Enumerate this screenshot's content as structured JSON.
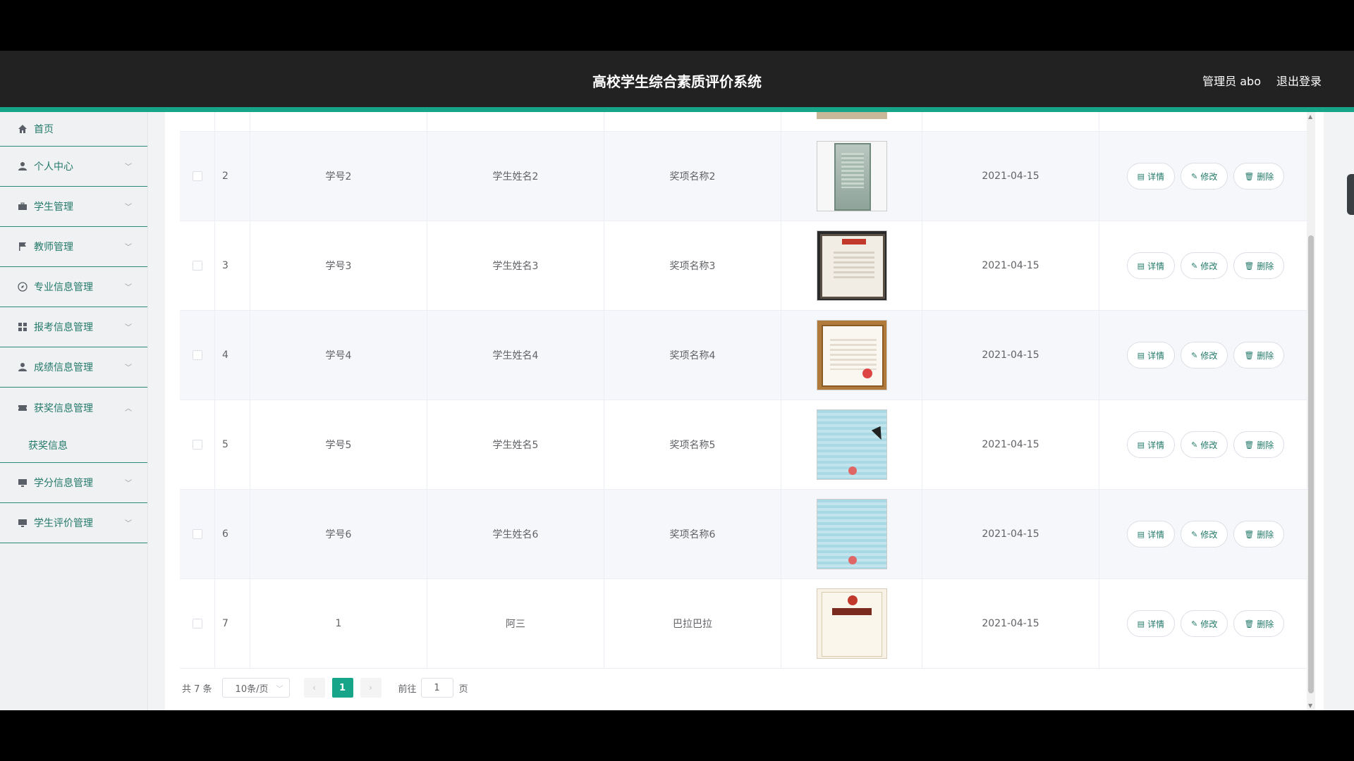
{
  "header": {
    "title": "高校学生综合素质评价系统",
    "user": "管理员 abo",
    "logout": "退出登录"
  },
  "sidebar": {
    "items": [
      {
        "label": "首页",
        "icon": "home-icon"
      },
      {
        "label": "个人中心",
        "icon": "user-icon"
      },
      {
        "label": "学生管理",
        "icon": "briefcase-icon"
      },
      {
        "label": "教师管理",
        "icon": "flag-icon"
      },
      {
        "label": "专业信息管理",
        "icon": "compass-icon"
      },
      {
        "label": "报考信息管理",
        "icon": "grid-icon"
      },
      {
        "label": "成绩信息管理",
        "icon": "user-icon"
      },
      {
        "label": "获奖信息管理",
        "icon": "ticket-icon"
      },
      {
        "label": "学分信息管理",
        "icon": "monitor-icon"
      },
      {
        "label": "学生评价管理",
        "icon": "monitor-icon"
      }
    ],
    "submenu": {
      "label": "获奖信息"
    }
  },
  "table": {
    "rows": [
      {
        "index": "2",
        "student_no": "学号2",
        "student_name": "学生姓名2",
        "award": "奖项名称2",
        "date": "2021-04-15",
        "image": "certificate-green"
      },
      {
        "index": "3",
        "student_no": "学号3",
        "student_name": "学生姓名3",
        "award": "奖项名称3",
        "date": "2021-04-15",
        "image": "certificate-dark-frame"
      },
      {
        "index": "4",
        "student_no": "学号4",
        "student_name": "学生姓名4",
        "award": "奖项名称4",
        "date": "2021-04-15",
        "image": "certificate-gold-frame"
      },
      {
        "index": "5",
        "student_no": "学号5",
        "student_name": "学生姓名5",
        "award": "奖项名称5",
        "date": "2021-04-15",
        "image": "certificate-blue"
      },
      {
        "index": "6",
        "student_no": "学号6",
        "student_name": "学生姓名6",
        "award": "奖项名称6",
        "date": "2021-04-15",
        "image": "certificate-blue"
      },
      {
        "index": "7",
        "student_no": "1",
        "student_name": "阿三",
        "award": "巴拉巴拉",
        "date": "2021-04-15",
        "image": "business-license"
      }
    ],
    "actions": {
      "detail": "详情",
      "edit": "修改",
      "delete": "删除"
    }
  },
  "pagination": {
    "total": "共 7 条",
    "page_size": "10条/页",
    "current_page": "1",
    "goto_label": "前往",
    "goto_value": "1",
    "goto_suffix": "页"
  },
  "colors": {
    "accent": "#17a589",
    "header_bg": "#222222",
    "link": "#23796a"
  }
}
